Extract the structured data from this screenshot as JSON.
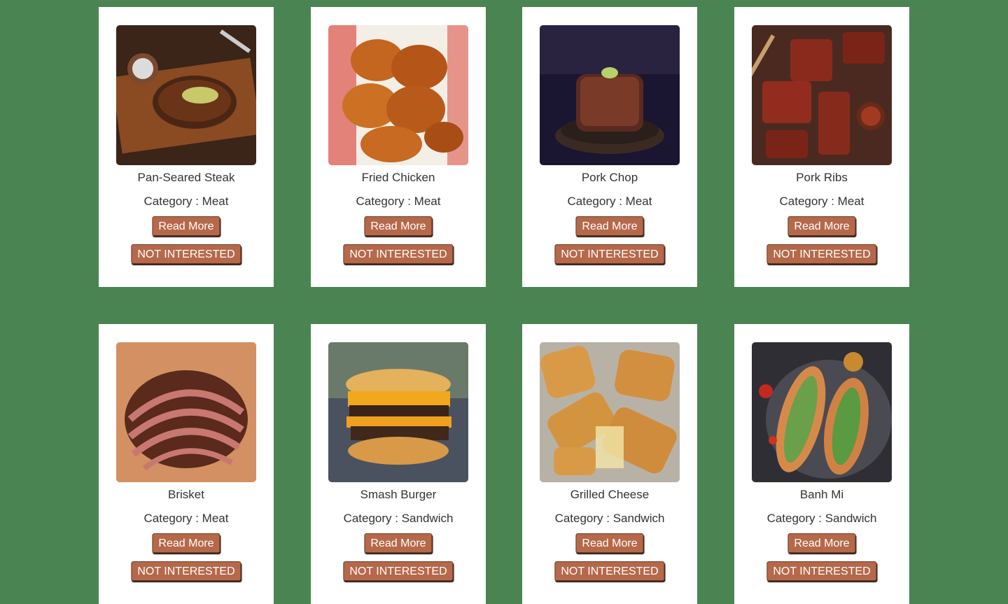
{
  "colors": {
    "background": "#4a8452",
    "card": "#ffffff",
    "button": "#b5694a",
    "button_text": "#ffffff",
    "text": "#333333"
  },
  "cards": [
    {
      "title": "Pan-Seared Steak",
      "category": "Category : Meat",
      "read_more": "Read More",
      "not_interested": "NOT INTERESTED",
      "image": "pan-seared-steak-photo"
    },
    {
      "title": "Fried Chicken",
      "category": "Category : Meat",
      "read_more": "Read More",
      "not_interested": "NOT INTERESTED",
      "image": "fried-chicken-photo"
    },
    {
      "title": "Pork Chop",
      "category": "Category : Meat",
      "read_more": "Read More",
      "not_interested": "NOT INTERESTED",
      "image": "pork-chop-photo"
    },
    {
      "title": "Pork Ribs",
      "category": "Category : Meat",
      "read_more": "Read More",
      "not_interested": "NOT INTERESTED",
      "image": "pork-ribs-photo"
    },
    {
      "title": "Brisket",
      "category": "Category : Meat",
      "read_more": "Read More",
      "not_interested": "NOT INTERESTED",
      "image": "brisket-photo"
    },
    {
      "title": "Smash Burger",
      "category": "Category : Sandwich",
      "read_more": "Read More",
      "not_interested": "NOT INTERESTED",
      "image": "smash-burger-photo"
    },
    {
      "title": "Grilled Cheese",
      "category": "Category : Sandwich",
      "read_more": "Read More",
      "not_interested": "NOT INTERESTED",
      "image": "grilled-cheese-photo"
    },
    {
      "title": "Banh Mi",
      "category": "Category : Sandwich",
      "read_more": "Read More",
      "not_interested": "NOT INTERESTED",
      "image": "banh-mi-photo"
    }
  ]
}
